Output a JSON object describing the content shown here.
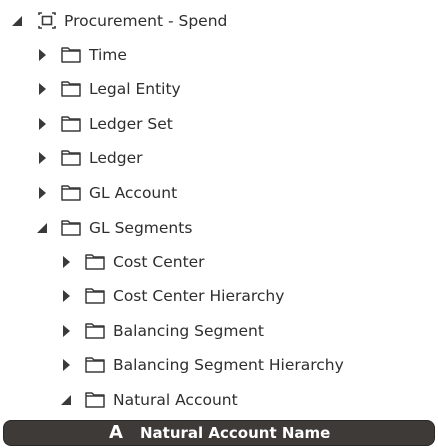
{
  "tree": {
    "root": {
      "label": "Procurement - Spend",
      "expanded": true,
      "icon": "subject-area-icon"
    },
    "folders": [
      {
        "label": "Time",
        "expanded": false
      },
      {
        "label": "Legal Entity",
        "expanded": false
      },
      {
        "label": "Ledger Set",
        "expanded": false
      },
      {
        "label": "Ledger",
        "expanded": false
      },
      {
        "label": "GL Account",
        "expanded": false
      },
      {
        "label": "GL Segments",
        "expanded": true,
        "children": [
          {
            "label": "Cost Center",
            "expanded": false
          },
          {
            "label": "Cost Center Hierarchy",
            "expanded": false
          },
          {
            "label": "Balancing Segment",
            "expanded": false
          },
          {
            "label": "Balancing Segment Hierarchy",
            "expanded": false
          },
          {
            "label": "Natural Account",
            "expanded": true,
            "children": [
              {
                "label": "Natural Account Name",
                "type": "attribute",
                "selected": true,
                "icon": "attribute-text-icon",
                "glyph": "A"
              }
            ]
          }
        ]
      }
    ]
  },
  "colors": {
    "selected_bg": "#3d3a38",
    "text": "#2e2e2e",
    "icon": "#3a3a3a"
  }
}
